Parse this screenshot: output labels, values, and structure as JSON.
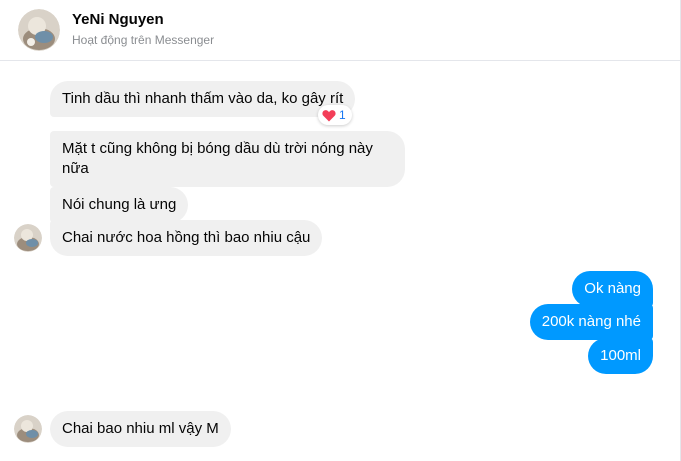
{
  "contact": {
    "name": "YeNi Nguyen",
    "status": "Hoạt động trên Messenger"
  },
  "messages": [
    {
      "side": "in",
      "text": "Tinh dầu thì nhanh thấm vào da, ko gây rít"
    },
    {
      "side": "in",
      "text": "Mặt t cũng không bị bóng dầu dù trời nóng này",
      "text2": "nữa"
    },
    {
      "side": "in",
      "text": "Nói chung là ưng"
    },
    {
      "side": "in",
      "text": "Chai nước hoa hồng thì bao nhiu cậu"
    },
    {
      "side": "out",
      "text": "Ok nàng"
    },
    {
      "side": "out",
      "text": "200k nàng nhé"
    },
    {
      "side": "out",
      "text": "100ml"
    },
    {
      "side": "in",
      "text": "Chai bao nhiu ml vậy M"
    }
  ],
  "reaction": {
    "icon": "heart-icon",
    "count": "1",
    "color": "#f33e58"
  },
  "colors": {
    "outgoing": "#0099ff",
    "incoming": "#f0f0f0"
  }
}
